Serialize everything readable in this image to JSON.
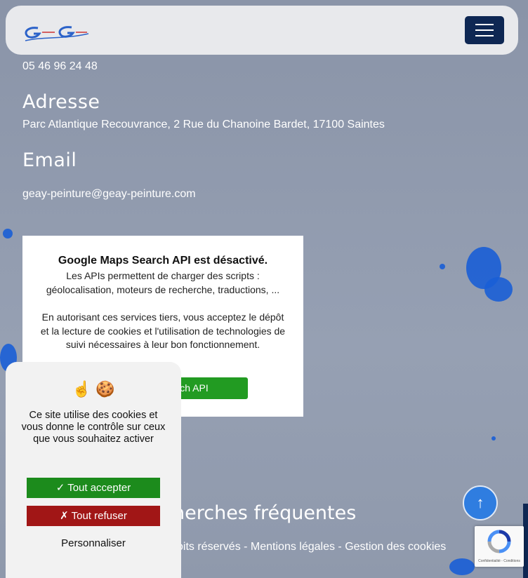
{
  "header": {
    "logo_icon": "geay-peinture-logo",
    "menu_icon": "hamburger-icon"
  },
  "contact": {
    "phone": "05 46 96 24 48",
    "address_title": "Adresse",
    "address": "Parc Atlantique Recouvrance, 2 Rue du Chanoine Bardet, 17100 Saintes",
    "email_title": "Email",
    "email": "geay-peinture@geay-peinture.com"
  },
  "maps_notice": {
    "title": "Google Maps Search API est désactivé.",
    "p1": "Les APIs permettent de charger des scripts : géolocalisation, moteurs de recherche, traductions, ...",
    "p2": "En autorisant ces services tiers, vous acceptez le dépôt et la lecture de cookies et l'utilisation de technologies de suivi nécessaires à leur bon fonctionnement.",
    "button": "ps Search API"
  },
  "cookie_banner": {
    "emoji": "☝ 🍪",
    "message": "Ce site utilise des cookies et vous donne le contrôle sur ceux que vous souhaitez activer",
    "accept": "✓ Tout accepter",
    "refuse": "✗ Tout refuser",
    "customize": "Personnaliser"
  },
  "footer": {
    "searches_title": "herches fréquentes",
    "links_text": "oits réservés - Mentions légales  -  Gestion des cookies"
  },
  "scroll_top": {
    "label": "↑"
  },
  "recaptcha": {
    "label": "Confidentialité - Conditions"
  },
  "colors": {
    "navy": "#0e2753",
    "accept_green": "#1c8b1c",
    "refuse_red": "#a11616",
    "maps_green": "#229b22",
    "splat_blue": "#1a5ed6"
  }
}
